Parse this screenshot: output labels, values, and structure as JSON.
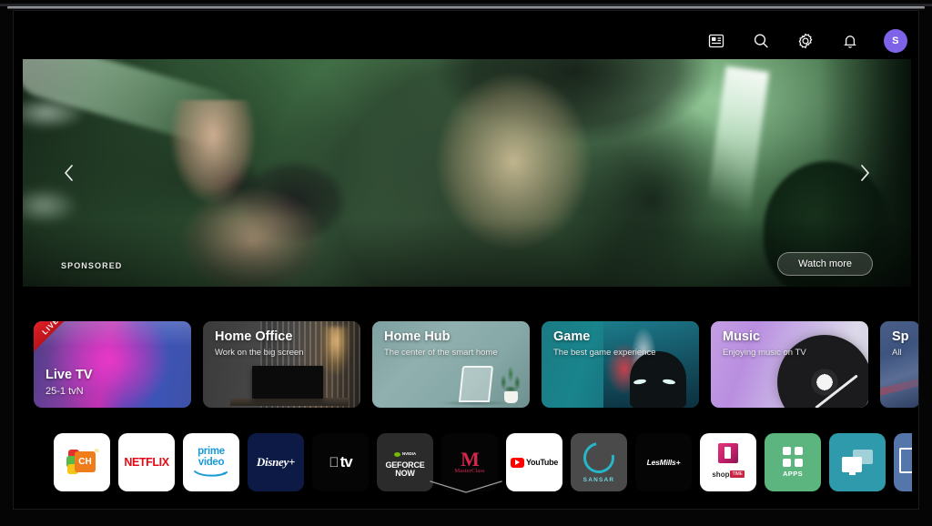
{
  "topbar": {
    "icons": [
      {
        "name": "media-list-icon",
        "label": "Media"
      },
      {
        "name": "search-icon",
        "label": "Search"
      },
      {
        "name": "gear-icon",
        "label": "Settings"
      },
      {
        "name": "bell-icon",
        "label": "Notifications"
      }
    ],
    "avatar": {
      "initial": "S",
      "color": "#7e62e8"
    }
  },
  "hero": {
    "sponsored_label": "SPONSORED",
    "watch_more_label": "Watch more",
    "prev_label": "‹",
    "next_label": "›"
  },
  "cards": [
    {
      "title": "Live TV",
      "subtitle": "25-1  tvN",
      "badge": "LIVE"
    },
    {
      "title": "Home Office",
      "subtitle": "Work on the big screen",
      "badge": ""
    },
    {
      "title": "Home Hub",
      "subtitle": "The center of the smart home",
      "badge": ""
    },
    {
      "title": "Game",
      "subtitle": "The best game experience",
      "badge": ""
    },
    {
      "title": "Music",
      "subtitle": "Enjoying music on TV",
      "badge": ""
    },
    {
      "title": "Sp",
      "subtitle": "All",
      "badge": ""
    }
  ],
  "apps": [
    {
      "name": "lg-channels",
      "label": "CH"
    },
    {
      "name": "netflix",
      "label": "NETFLIX"
    },
    {
      "name": "prime-video",
      "label_line1": "prime",
      "label_line2": "video"
    },
    {
      "name": "disney-plus",
      "label": "Disney+"
    },
    {
      "name": "apple-tv",
      "label": "tv"
    },
    {
      "name": "geforce-now",
      "brand": "NVIDIA",
      "label_line1": "GEFORCE",
      "label_line2": "NOW"
    },
    {
      "name": "masterclass",
      "label": "MasterClass",
      "mark": "M"
    },
    {
      "name": "youtube",
      "label": "YouTube"
    },
    {
      "name": "sansar",
      "label": "SANSAR"
    },
    {
      "name": "lesmills-plus",
      "label": "LesMills+"
    },
    {
      "name": "shop-time",
      "label": "shop",
      "badge": "TIME"
    },
    {
      "name": "apps",
      "label": "APPS"
    },
    {
      "name": "screen-share",
      "label": ""
    },
    {
      "name": "more-app",
      "label": ""
    }
  ],
  "footer": {
    "expand_label": "More"
  }
}
